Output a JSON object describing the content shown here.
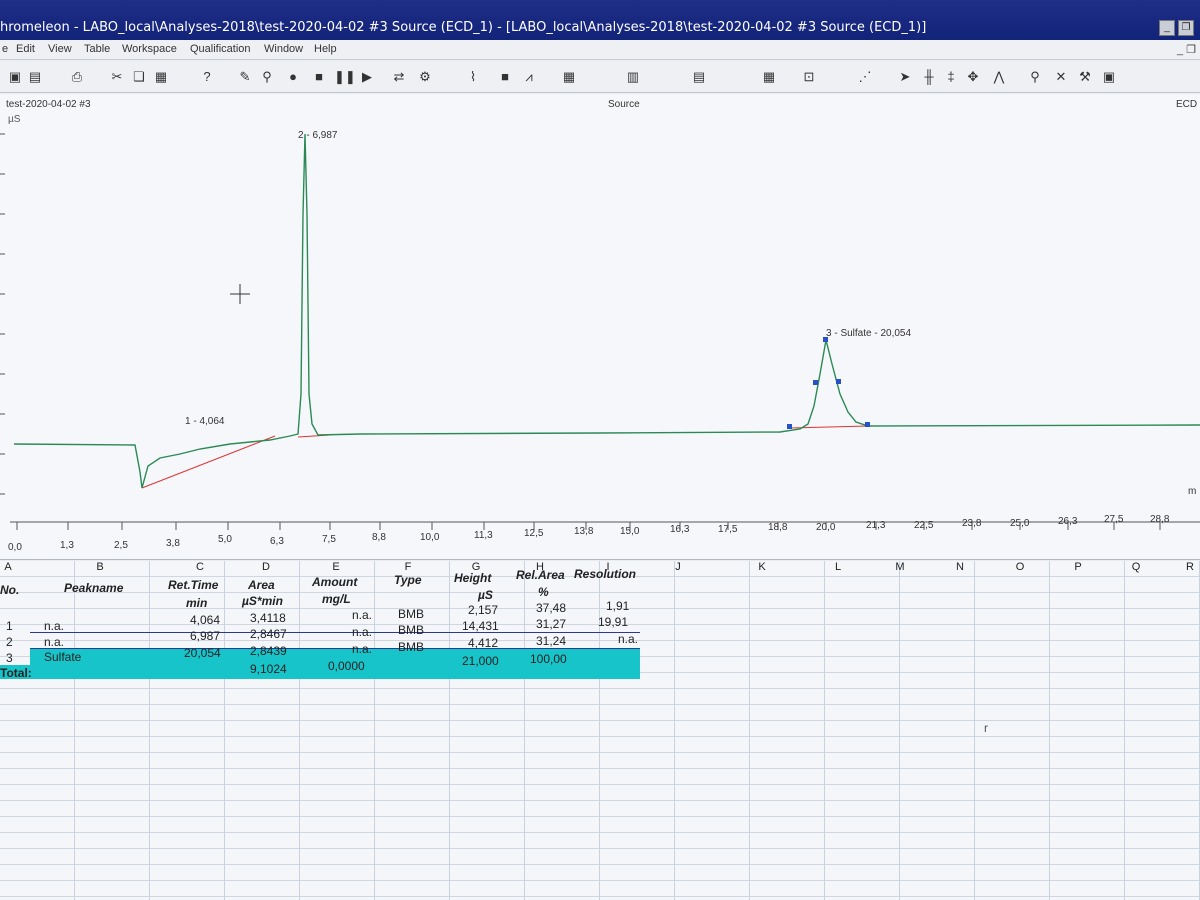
{
  "window": {
    "title": "hromeleon - LABO_local\\Analyses-2018\\test-2020-04-02 #3 Source (ECD_1) - [LABO_local\\Analyses-2018\\test-2020-04-02 #3 Source (ECD_1)]"
  },
  "menu": [
    "e",
    "Edit",
    "View",
    "Table",
    "Workspace",
    "Qualification",
    "Window",
    "Help"
  ],
  "toolbar_icons": [
    "save-icon",
    "open-icon",
    "print-icon",
    "cut-icon",
    "copy-icon",
    "paste-icon",
    "help-icon",
    "cursor-icon",
    "pipette-icon",
    "record-icon",
    "stop-icon",
    "pause-icon",
    "play-icon",
    "sync-icon",
    "settings-icon",
    "chart-icon",
    "grid-icon",
    "peak-icon",
    "table-icon",
    "zoom-icon",
    "search-icon",
    "tools-icon"
  ],
  "plot": {
    "left_label": "test-2020-04-02 #3",
    "center_label": "Source",
    "right_label": "ECD",
    "y_unit": "µS",
    "right_small": "m",
    "peak_labels": [
      "1 - 4,064",
      "2 - 6,987",
      "3 - Sulfate - 20,054"
    ],
    "x_ticks_top": [
      "5,0",
      "6,3",
      "7,5",
      "8,8",
      "10,0",
      "11,3",
      "12,5",
      "13,8",
      "15,0",
      "16,3",
      "17,5",
      "18,8",
      "20,0",
      "21,3",
      "22,5",
      "23,8",
      "25,0",
      "26,3",
      "27,5",
      "28,8"
    ],
    "x_ticks_bottom": [
      "0,0",
      "1,3",
      "2,5",
      "3,8"
    ]
  },
  "grid": {
    "col_letters": [
      "A",
      "B",
      "C",
      "D",
      "E",
      "F",
      "G",
      "H",
      "I",
      "J",
      "K",
      "L",
      "M",
      "N",
      "O",
      "P",
      "Q",
      "R"
    ],
    "headers": {
      "no": "No.",
      "peakname": "Peakname",
      "rettime": "Ret.Time",
      "rettime_unit": "min",
      "area": "Area",
      "area_unit": "µS*min",
      "amount": "Amount",
      "amount_unit": "mg/L",
      "type": "Type",
      "height": "Height",
      "height_unit": "µS",
      "relarea": "Rel.Area",
      "relarea_unit": "%",
      "resolution": "Resolution"
    },
    "rows": [
      {
        "no": "1",
        "name": "n.a.",
        "rt": "4,064",
        "area": "3,4118",
        "amount": "n.a.",
        "type": "BMB",
        "height": "2,157",
        "relarea": "37,48",
        "res": "1,91"
      },
      {
        "no": "2",
        "name": "n.a.",
        "rt": "6,987",
        "area": "2,8467",
        "amount": "n.a.",
        "type": "BMB",
        "height": "14,431",
        "relarea": "31,27",
        "res": "19,91"
      },
      {
        "no": "3",
        "name": "Sulfate",
        "rt": "20,054",
        "area": "2,8439",
        "amount": "n.a.",
        "type": "BMB",
        "height": "4,412",
        "relarea": "31,24",
        "res": "n.a."
      }
    ],
    "total": {
      "label": "Total:",
      "area": "9,1024",
      "amount": "0,0000",
      "height": "21,000",
      "relarea": "100,00"
    },
    "stray": "r"
  }
}
